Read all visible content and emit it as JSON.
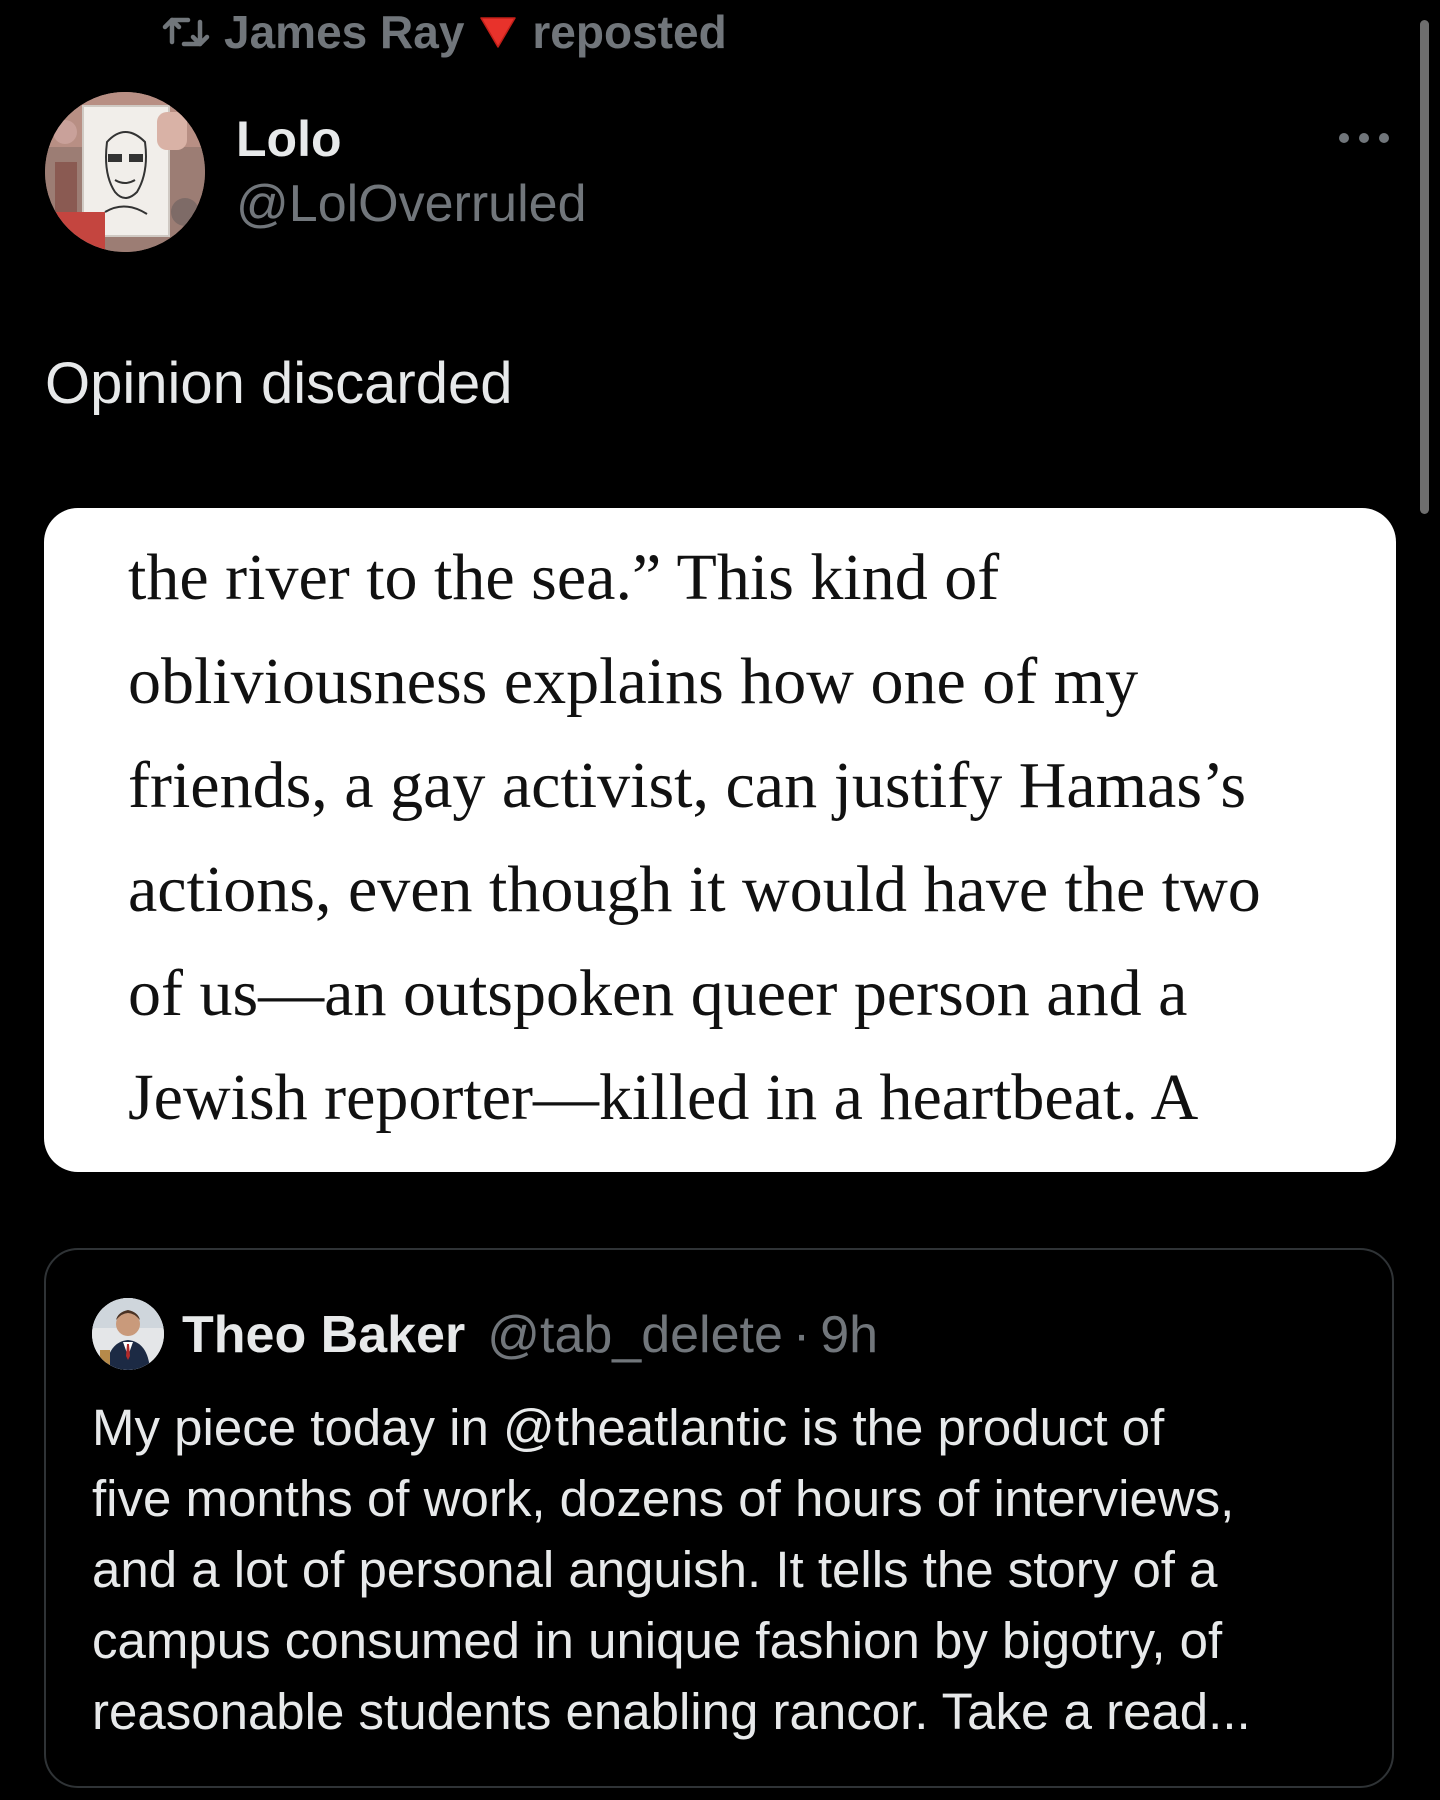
{
  "repost": {
    "icon": "repost-icon",
    "user": "James Ray",
    "emoji": "red-triangle-down",
    "label": "reposted"
  },
  "post": {
    "avatar": "avatar-sketch-image",
    "name": "Lolo",
    "handle": "@LolOverruled",
    "more_icon": "more-horizontal-icon",
    "text": "Opinion discarded",
    "media_lines": [
      "the river to the sea.” This kind of",
      "obliviousness explains how one of my",
      "friends, a gay activist, can justify Hamas’s",
      "actions, even though it would have the two",
      "of us—an outspoken queer person and a",
      "Jewish reporter—killed in a heartbeat. A"
    ]
  },
  "quote": {
    "avatar": "avatar-photo",
    "name": "Theo Baker",
    "handle": "@tab_delete",
    "separator": "·",
    "time": "9h",
    "lines": [
      "My piece today in @theatlantic is the product of",
      "five months of work, dozens of hours of interviews,",
      "and a lot of personal anguish. It tells the story of a",
      "campus consumed in unique fashion by bigotry, of",
      "reasonable students enabling rancor. Take a read..."
    ]
  },
  "colors": {
    "background": "#000000",
    "primary_text": "#e7e9ea",
    "secondary_text": "#71767b",
    "border": "#2f3336",
    "accent_red": "#e8322b"
  }
}
